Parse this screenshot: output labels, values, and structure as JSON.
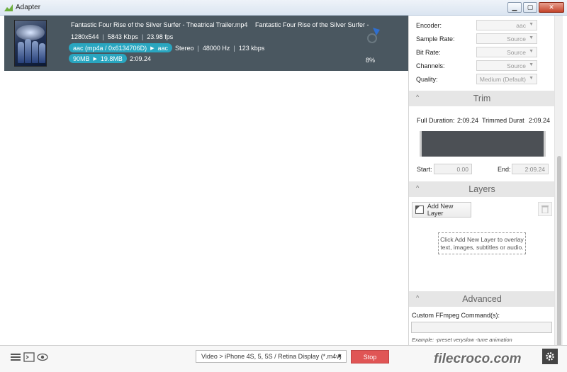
{
  "window": {
    "title": "Adapter",
    "controls": {
      "minimize": "▁",
      "maximize": "▢",
      "close": "✕"
    }
  },
  "queue": {
    "item": {
      "file_name": "Fantastic Four Rise of the Silver Surfer - Theatrical Trailer.mp4",
      "output_name": "Fantastic Four Rise of the Silver Surfer -",
      "resolution": "1280x544",
      "video_bitrate": "5843 Kbps",
      "fps": "23.98 fps",
      "audio_conversion": {
        "from": "aac (mp4a / 0x6134706D)",
        "to": "aac"
      },
      "channels": "Stereo",
      "sample_rate": "48000 Hz",
      "audio_bitrate": "123 kbps",
      "size_conversion": {
        "from": "90MB",
        "to": "19.8MB"
      },
      "duration": "2:09.24",
      "progress_label": "8%",
      "progress": 0.08
    }
  },
  "settings": {
    "audio": [
      {
        "label": "Encoder:",
        "value": "aac"
      },
      {
        "label": "Sample Rate:",
        "value": "Source"
      },
      {
        "label": "Bit Rate:",
        "value": "Source"
      },
      {
        "label": "Channels:",
        "value": "Source"
      },
      {
        "label": "Quality:",
        "value": "Medium (Default)"
      }
    ],
    "trim": {
      "title": "Trim",
      "full_duration_label": "Full Duration:",
      "full_duration": "2:09.24",
      "trimmed_label": "Trimmed Durat",
      "trimmed": "2:09.24",
      "start_label": "Start:",
      "start": "0.00",
      "end_label": "End:",
      "end": "2:09.24"
    },
    "layers": {
      "title": "Layers",
      "add_label": "Add New Layer",
      "hint": "Click Add New Layer to overlay text, images, subtitles or audio."
    },
    "advanced": {
      "title": "Advanced",
      "custom_label": "Custom FFmpeg Command(s):",
      "custom_value": "",
      "example": "Example: -preset veryslow -tune animation"
    }
  },
  "bottom": {
    "preset": "Video > iPhone 4S, 5, 5S / Retina Display (*.m4v)",
    "stop_label": "Stop"
  },
  "watermark": "filecroco.com",
  "colors": {
    "item_bg": "#4a5760",
    "pill": "#29a6c0",
    "spinner": "#2f6fd0",
    "stop": "#e05555"
  }
}
